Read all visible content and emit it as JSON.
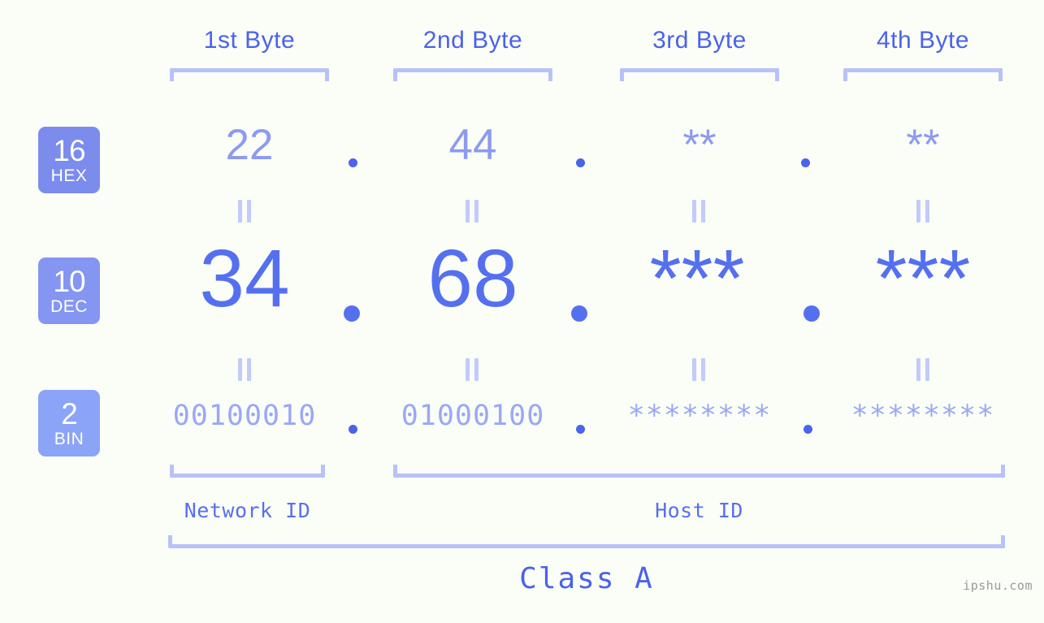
{
  "page": {
    "background_color": "#fbfdf7",
    "accent_color": "#4a63ea",
    "watermark": "ipshu.com"
  },
  "byte_headers": [
    {
      "label": "1st Byte"
    },
    {
      "label": "2nd Byte"
    },
    {
      "label": "3rd Byte"
    },
    {
      "label": "4th Byte"
    }
  ],
  "rows": [
    {
      "badge_number": "16",
      "badge_abbr": "HEX",
      "badge_color": "#7b8ced",
      "values": [
        "22",
        "44",
        "**",
        "**"
      ],
      "separator": "."
    },
    {
      "badge_number": "10",
      "badge_abbr": "DEC",
      "badge_color": "#8496f2",
      "values": [
        "34",
        "68",
        "***",
        "***"
      ],
      "separator": "."
    },
    {
      "badge_number": "2",
      "badge_abbr": "BIN",
      "badge_color": "#8ba4f8",
      "values": [
        "00100010",
        "01000100",
        "********",
        "********"
      ],
      "separator": "."
    }
  ],
  "segments": {
    "network_id": "Network ID",
    "host_id": "Host ID",
    "class": "Class A"
  }
}
